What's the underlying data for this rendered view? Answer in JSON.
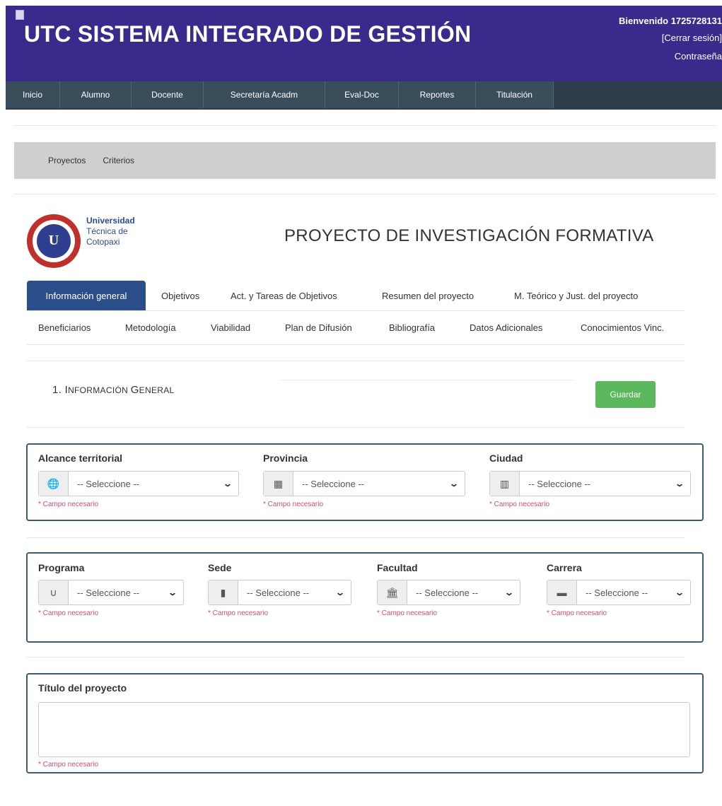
{
  "header": {
    "title": "UTC SISTEMA INTEGRADO DE GESTIÓN",
    "welcome": "Bienvenido 1725728131",
    "logout": "[Cerrar sesión]",
    "password": "Contraseña",
    "bg_color": "#3a2a8c"
  },
  "main_nav": {
    "items": [
      "Inicio",
      "Alumno",
      "Docente",
      "Secretaría Acadm",
      "Eval-Doc",
      "Reportes",
      "Titulación"
    ]
  },
  "sub_nav": {
    "items": [
      "Proyectos",
      "Criterios"
    ]
  },
  "logo": {
    "lines": [
      "Universidad",
      "Técnica de",
      "Cotopaxi"
    ],
    "seal_letter": "U"
  },
  "page_title": "PROYECTO DE INVESTIGACIÓN FORMATIVA",
  "tabs": {
    "row1": [
      "Información general",
      "Objetivos",
      "Act. y Tareas de Objetivos",
      "Resumen del proyecto",
      "M. Teórico y Just. del proyecto"
    ],
    "row2": [
      "Beneficiarios",
      "Metodología",
      "Viabilidad",
      "Plan de Difusión",
      "Bibliografía",
      "Datos Adicionales",
      "Conocimientos Vinc."
    ],
    "active": "Información general"
  },
  "section": {
    "number": "1.",
    "title_cap1": "I",
    "title_rest1": "NFORMACIÓN ",
    "title_cap2": "G",
    "title_rest2": "ENERAL",
    "save_label": "Guardar"
  },
  "panel1": {
    "fields": [
      {
        "label": "Alcance territorial",
        "value": "-- Seleccione --",
        "icon": "globe-icon",
        "help": "* Campo necesario"
      },
      {
        "label": "Provincia",
        "value": "-- Seleccione --",
        "icon": "building-icon",
        "help": "* Campo necesario"
      },
      {
        "label": "Ciudad",
        "value": "-- Seleccione --",
        "icon": "city-icon",
        "help": "* Campo necesario"
      }
    ]
  },
  "panel2": {
    "fields": [
      {
        "label": "Programa",
        "value": "-- Seleccione --",
        "icon": "magnet-icon",
        "help": "* Campo necesario"
      },
      {
        "label": "Sede",
        "value": "-- Seleccione --",
        "icon": "building-icon",
        "help": "* Campo necesario"
      },
      {
        "label": "Facultad",
        "value": "-- Seleccione --",
        "icon": "institution-icon",
        "help": "* Campo necesario"
      },
      {
        "label": "Carrera",
        "value": "-- Seleccione --",
        "icon": "book-icon",
        "help": "* Campo necesario"
      }
    ]
  },
  "panel3": {
    "label": "Título del proyecto",
    "value": "",
    "help": "* Campo necesario"
  },
  "colors": {
    "header": "#3a2a8c",
    "nav": "#3a4d5a",
    "active_tab": "#2b4d8a",
    "save_button": "#5cb85c",
    "panel_border": "#3c5a72",
    "help_text": "#d04b7a"
  }
}
